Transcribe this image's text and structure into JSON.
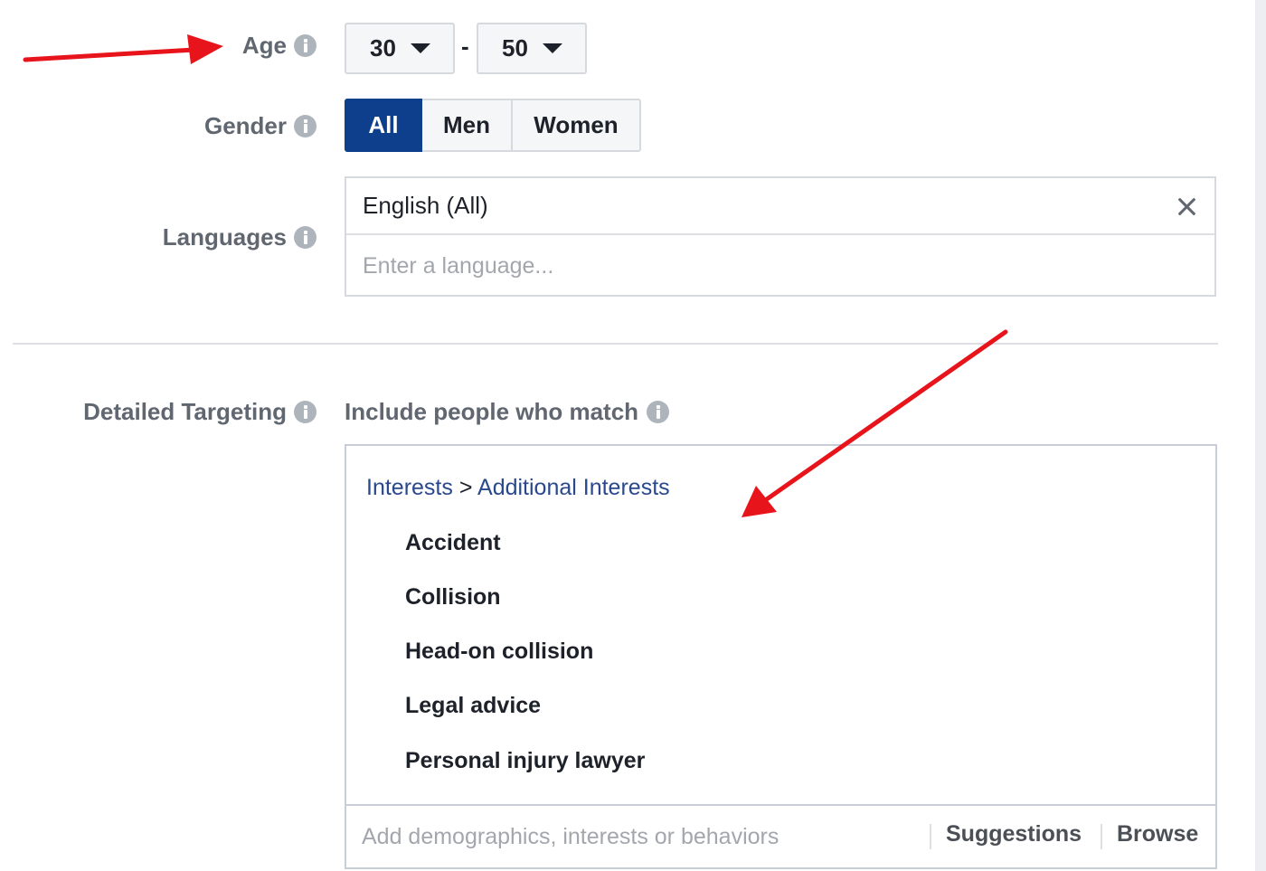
{
  "age": {
    "label": "Age",
    "min": "30",
    "separator": "-",
    "max": "50"
  },
  "gender": {
    "label": "Gender",
    "options": [
      "All",
      "Men",
      "Women"
    ],
    "selected": "All"
  },
  "languages": {
    "label": "Languages",
    "selected_token": "English (All)",
    "input_value": "",
    "input_placeholder": "Enter a language..."
  },
  "detailed_targeting": {
    "label": "Detailed Targeting",
    "include_label": "Include people who match",
    "breadcrumb": {
      "root": "Interests",
      "separator": ">",
      "child": "Additional Interests"
    },
    "interests": [
      "Accident",
      "Collision",
      "Head-on collision",
      "Legal advice",
      "Personal injury lawyer"
    ],
    "input_value": "",
    "input_placeholder": "Add demographics, interests or behaviors",
    "suggestions_label": "Suggestions",
    "browse_label": "Browse"
  },
  "colors": {
    "selected_button": "#0d3f8c",
    "link": "#29498c",
    "label_text": "#616770",
    "annotation_arrow": "#e8141b",
    "info_icon": "#aeb4bc"
  },
  "icons": {
    "info": "info-icon",
    "dropdown": "caret-down-icon",
    "remove": "close-icon",
    "annotation": "red-arrow-annotation"
  }
}
